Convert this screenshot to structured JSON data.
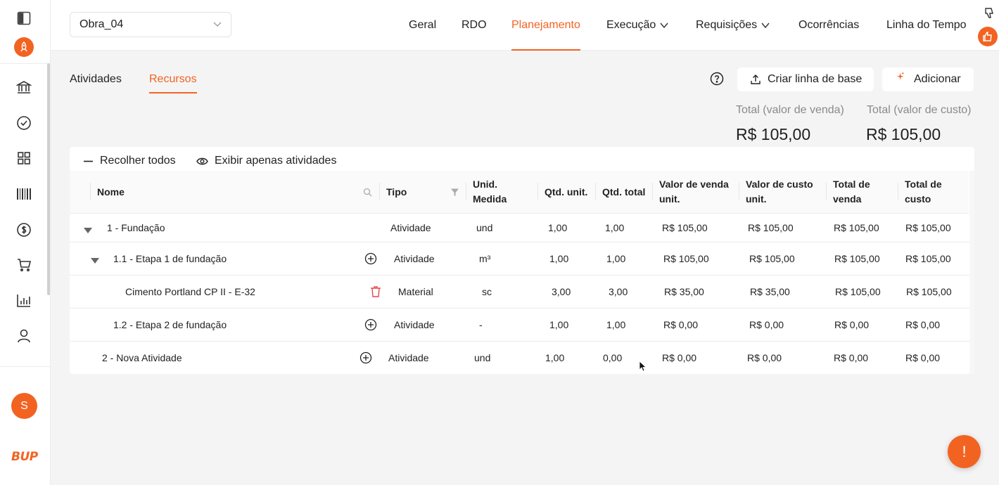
{
  "project": {
    "selected": "Obra_04"
  },
  "nav": {
    "items": [
      {
        "label": "Geral"
      },
      {
        "label": "RDO"
      },
      {
        "label": "Planejamento"
      },
      {
        "label": "Execução"
      },
      {
        "label": "Requisições"
      },
      {
        "label": "Ocorrências"
      },
      {
        "label": "Linha do Tempo"
      }
    ],
    "active": "Planejamento"
  },
  "sidebar": {
    "icons": [
      "panel-toggle-icon",
      "rocket-icon",
      "bank-icon",
      "check-circle-icon",
      "grid-icon",
      "barcode-icon",
      "dollar-icon",
      "cart-icon",
      "bar-chart-icon",
      "user-icon"
    ],
    "avatar": "S",
    "brand": "BUP"
  },
  "subtabs": [
    {
      "label": "Atividades"
    },
    {
      "label": "Recursos"
    }
  ],
  "actions": {
    "baseline_label": "Criar linha de base",
    "add_label": "Adicionar"
  },
  "totals": {
    "sale_label": "Total (valor de venda)",
    "sale_value": "R$ 105,00",
    "cost_label": "Total (valor de custo)",
    "cost_value": "R$ 105,00"
  },
  "toolbar": {
    "collapse_label": "Recolher todos",
    "show_only_label": "Exibir apenas atividades"
  },
  "table": {
    "columns": {
      "nome": "Nome",
      "tipo": "Tipo",
      "unid_1": "Unid.",
      "unid_2": "Medida",
      "qtd_unit": "Qtd. unit.",
      "qtd_total": "Qtd. total",
      "venda_unit_1": "Valor de venda",
      "venda_unit_2": "unit.",
      "custo_unit_1": "Valor de custo",
      "custo_unit_2": "unit.",
      "total_venda_1": "Total de",
      "total_venda_2": "venda",
      "total_custo_1": "Total de",
      "total_custo_2": "custo"
    },
    "rows": [
      {
        "nome": "1 - Fundação",
        "tipo": "Atividade",
        "unid": "und",
        "qtd_unit": "1,00",
        "qtd_total": "1,00",
        "venda_unit": "R$ 105,00",
        "custo_unit": "R$ 105,00",
        "total_venda": "R$ 105,00",
        "total_custo": "R$ 105,00"
      },
      {
        "nome": "1.1 - Etapa 1 de fundação",
        "tipo": "Atividade",
        "unid": "m³",
        "qtd_unit": "1,00",
        "qtd_total": "1,00",
        "venda_unit": "R$ 105,00",
        "custo_unit": "R$ 105,00",
        "total_venda": "R$ 105,00",
        "total_custo": "R$ 105,00"
      },
      {
        "nome": "Cimento Portland CP II - E-32",
        "tipo": "Material",
        "unid": "sc",
        "qtd_unit": "3,00",
        "qtd_total": "3,00",
        "venda_unit": "R$ 35,00",
        "custo_unit": "R$ 35,00",
        "total_venda": "R$ 105,00",
        "total_custo": "R$ 105,00"
      },
      {
        "nome": "1.2 - Etapa 2 de fundação",
        "tipo": "Atividade",
        "unid": "-",
        "qtd_unit": "1,00",
        "qtd_total": "1,00",
        "venda_unit": "R$ 0,00",
        "custo_unit": "R$ 0,00",
        "total_venda": "R$ 0,00",
        "total_custo": "R$ 0,00"
      },
      {
        "nome": "2 - Nova Atividade",
        "tipo": "Atividade",
        "unid": "und",
        "qtd_unit": "1,00",
        "qtd_total": "0,00",
        "venda_unit": "R$ 0,00",
        "custo_unit": "R$ 0,00",
        "total_venda": "R$ 0,00",
        "total_custo": "R$ 0,00"
      }
    ]
  },
  "fab": {
    "label": "!"
  },
  "colors": {
    "accent": "#f26322",
    "danger": "#e5484d"
  }
}
